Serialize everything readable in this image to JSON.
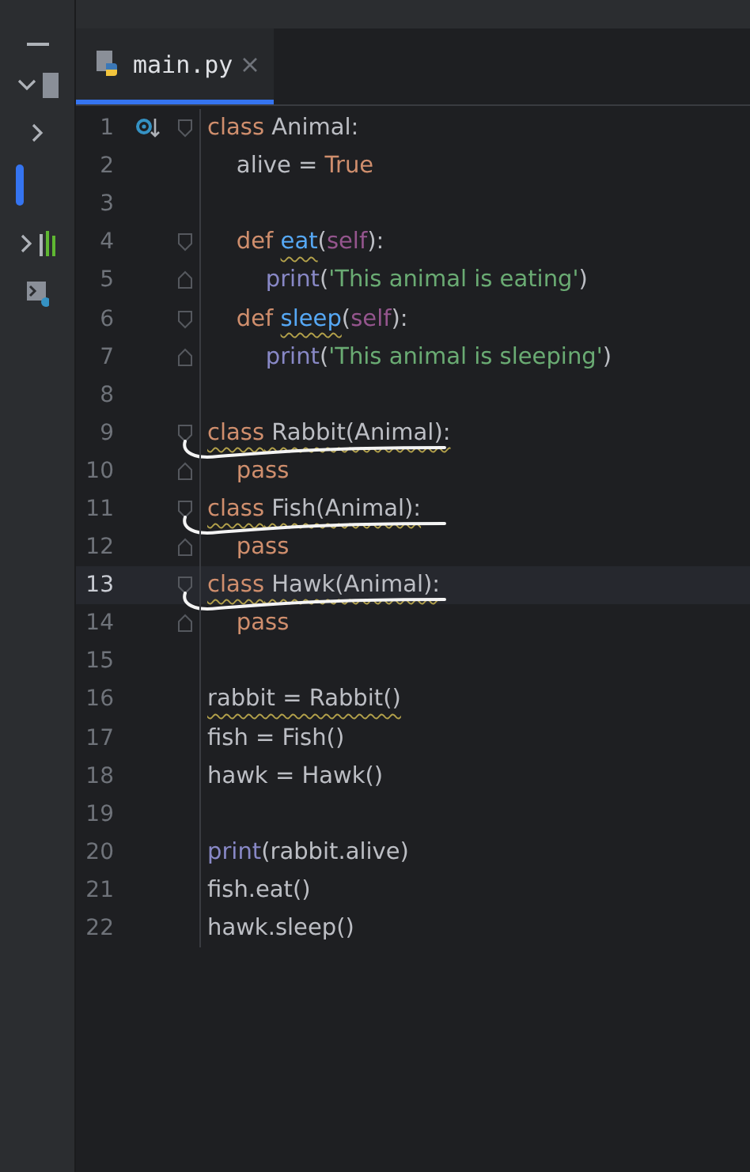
{
  "tabs": [
    {
      "label": "main.py",
      "selected": true
    }
  ],
  "lines": [
    {
      "number": "1",
      "current": false,
      "marked": false,
      "fold_start": true,
      "fold_end": false,
      "tokens": [
        {
          "text": "class",
          "kind": "keyword"
        },
        {
          "text": " Animal:",
          "kind": "plain"
        }
      ]
    },
    {
      "number": "2",
      "current": false,
      "marked": false,
      "fold_start": false,
      "fold_end": false,
      "tokens": [
        {
          "text": "    alive = ",
          "kind": "plain"
        },
        {
          "text": "True",
          "kind": "keyword"
        }
      ]
    },
    {
      "number": "3",
      "current": false,
      "marked": false,
      "fold_start": false,
      "fold_end": false
    },
    {
      "number": "4",
      "current": false,
      "marked": false,
      "fold_start": true,
      "fold_end": false,
      "tokens": [
        {
          "text": "    def ",
          "kind": "keyword"
        },
        {
          "text": "eat",
          "kind": "function",
          "warn": true
        },
        {
          "text": "(",
          "kind": "plain"
        },
        {
          "text": "self",
          "kind": "self"
        },
        {
          "text": "):",
          "kind": "plain"
        }
      ]
    },
    {
      "number": "5",
      "current": false,
      "marked": false,
      "fold_start": false,
      "fold_end": true,
      "tokens": [
        {
          "text": "        print",
          "kind": "builtin"
        },
        {
          "text": "(",
          "kind": "plain"
        },
        {
          "text": "'This animal is eating'",
          "kind": "string"
        },
        {
          "text": ")",
          "kind": "plain"
        }
      ]
    },
    {
      "number": "6",
      "current": false,
      "marked": false,
      "fold_start": true,
      "fold_end": false,
      "tokens": [
        {
          "text": "    def ",
          "kind": "keyword"
        },
        {
          "text": "sleep",
          "kind": "function",
          "warn": true
        },
        {
          "text": "(",
          "kind": "plain"
        },
        {
          "text": "self",
          "kind": "self"
        },
        {
          "text": "):",
          "kind": "plain"
        }
      ]
    },
    {
      "number": "7",
      "current": false,
      "marked": false,
      "fold_start": false,
      "fold_end": true,
      "tokens": [
        {
          "text": "        print",
          "kind": "builtin"
        },
        {
          "text": "(",
          "kind": "plain"
        },
        {
          "text": "'This animal is sleeping'",
          "kind": "string"
        },
        {
          "text": ")",
          "kind": "plain"
        }
      ]
    },
    {
      "number": "8",
      "current": false,
      "marked": false,
      "fold_start": false,
      "fold_end": false
    },
    {
      "number": "9",
      "current": false,
      "marked": true,
      "fold_start": true,
      "fold_end": false,
      "tokens": [
        {
          "text": "class",
          "kind": "keyword",
          "warn": true
        },
        {
          "text": " Rabbit(Animal):",
          "kind": "plain",
          "warn": true
        }
      ]
    },
    {
      "number": "10",
      "current": false,
      "marked": false,
      "fold_start": false,
      "fold_end": true,
      "tokens": [
        {
          "text": "    pass",
          "kind": "keyword"
        }
      ]
    },
    {
      "number": "11",
      "current": false,
      "marked": true,
      "fold_start": true,
      "fold_end": false,
      "tokens": [
        {
          "text": "class",
          "kind": "keyword",
          "warn": true
        },
        {
          "text": " Fish(Animal):",
          "kind": "plain",
          "warn": true
        }
      ]
    },
    {
      "number": "12",
      "current": false,
      "marked": false,
      "fold_start": false,
      "fold_end": true,
      "tokens": [
        {
          "text": "    pass",
          "kind": "keyword"
        }
      ]
    },
    {
      "number": "13",
      "current": true,
      "marked": true,
      "fold_start": true,
      "fold_end": false,
      "tokens": [
        {
          "text": "class",
          "kind": "keyword",
          "warn": true
        },
        {
          "text": " Hawk(Animal):",
          "kind": "plain",
          "warn": true
        }
      ]
    },
    {
      "number": "14",
      "current": false,
      "marked": false,
      "fold_start": false,
      "fold_end": true,
      "tokens": [
        {
          "text": "    pass",
          "kind": "keyword"
        }
      ]
    },
    {
      "number": "15",
      "current": false,
      "marked": false,
      "fold_start": false,
      "fold_end": false
    },
    {
      "number": "16",
      "current": false,
      "marked": false,
      "fold_start": false,
      "fold_end": false,
      "tokens": [
        {
          "text": "rabbit = Rabbit()",
          "kind": "plain",
          "warn": true
        }
      ]
    },
    {
      "number": "17",
      "current": false,
      "marked": false,
      "fold_start": false,
      "fold_end": false,
      "tokens": [
        {
          "text": "fish = Fish()",
          "kind": "plain"
        }
      ]
    },
    {
      "number": "18",
      "current": false,
      "marked": false,
      "fold_start": false,
      "fold_end": false,
      "tokens": [
        {
          "text": "hawk = Hawk()",
          "kind": "plain"
        }
      ]
    },
    {
      "number": "19",
      "current": false,
      "marked": false,
      "fold_start": false,
      "fold_end": false
    },
    {
      "number": "20",
      "current": false,
      "marked": false,
      "fold_start": false,
      "fold_end": false,
      "tokens": [
        {
          "text": "print",
          "kind": "builtin"
        },
        {
          "text": "(rabbit.alive)",
          "kind": "plain"
        }
      ]
    },
    {
      "number": "21",
      "current": false,
      "marked": false,
      "fold_start": false,
      "fold_end": false,
      "tokens": [
        {
          "text": "fish.eat()",
          "kind": "plain"
        }
      ]
    },
    {
      "number": "22",
      "current": false,
      "marked": false,
      "fold_start": false,
      "fold_end": false,
      "tokens": [
        {
          "text": "hawk.sleep()",
          "kind": "plain"
        }
      ]
    }
  ]
}
